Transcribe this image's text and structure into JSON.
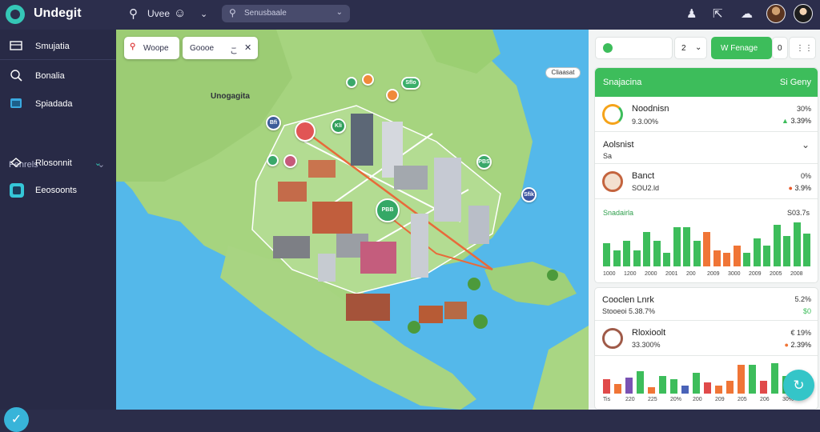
{
  "header": {
    "title": "Undegit",
    "nav_label": "Uvee",
    "search_placeholder": "Senusbaale"
  },
  "sidebar": {
    "items": [
      {
        "label": "Smujatia",
        "icon": "map-icon"
      },
      {
        "label": "Bonalia",
        "icon": "search-icon"
      },
      {
        "label": "Spiadada",
        "icon": "calendar-icon"
      }
    ],
    "section_label": "Fenrels",
    "sub_items": [
      {
        "label": "Rlosonnit",
        "icon": "layers-icon"
      },
      {
        "label": "Eeosoonts",
        "icon": "grid-icon"
      }
    ]
  },
  "map": {
    "filter_label": "Woope",
    "search_text": "Goooe",
    "control_label": "こ",
    "region_label": "Unogagita",
    "tag_label": "Cliaasat",
    "pins": [
      "Bfi",
      "Kli",
      "Sflo",
      "PBS",
      "PBB",
      "Sfik"
    ]
  },
  "panel": {
    "toolbar": {
      "stepper_value": "2",
      "action_label": "W Fenage",
      "count": "0"
    },
    "summary": {
      "title": "Snajacina",
      "right_label": "Si Geny"
    },
    "rows": [
      {
        "name": "Noodnisn",
        "sub": "9.3.00%",
        "value": "30%",
        "change": "3.39%"
      },
      {
        "name": "Aolsnist",
        "sub": "Sa"
      },
      {
        "name": "Banct",
        "sub": "SOU2.ld",
        "value": "0%",
        "change": "3.9%"
      }
    ],
    "chart1": {
      "left_label": "Snadairla",
      "right_label": "S03.7s",
      "x_labels": [
        "1000",
        "1200",
        "2000",
        "2001",
        "200",
        "2009",
        "3000",
        "2009",
        "2005",
        "2008"
      ]
    },
    "section2": {
      "name": "Cooclen Lnrk",
      "sub": "Stooeoi 5.38.7%",
      "value": "5.2%",
      "change": "$0"
    },
    "row4": {
      "name": "Rloxioolt",
      "sub": "33.300%",
      "value": "€ 19%",
      "change": "2.39%"
    },
    "chart2": {
      "x_labels": [
        "Tis",
        "220",
        "225",
        "20%",
        "200",
        "209",
        "205",
        "206",
        "30%"
      ]
    }
  },
  "colors": {
    "accent": "#3dbd5b",
    "navy": "#2c2e4c",
    "teal": "#34c5c8",
    "orange": "#f07536",
    "red": "#e04a4a"
  }
}
